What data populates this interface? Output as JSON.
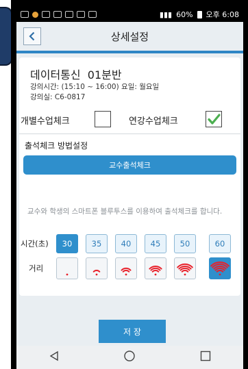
{
  "statusbar": {
    "signal": "60%",
    "time": "오후 6:08"
  },
  "header": {
    "title": "상세설정",
    "back_icon": "chevron-left-icon"
  },
  "course": {
    "name": "데이터통신  01분반",
    "time_line": "강의시간: (15:10 ~ 16:00)  요일: 월요일",
    "room_line": "강의실: C6-0817"
  },
  "checks": {
    "individual_label": "개별수업체크",
    "individual_checked": false,
    "consecutive_label": "연강수업체크",
    "consecutive_checked": true
  },
  "method": {
    "label": "출석체크 방법설정",
    "button_label": "교수출석체크",
    "description": "교수와 학생의 스마트폰 블루투스를 이용하여 출석체크를 합니다."
  },
  "time_row": {
    "label": "시간(초)",
    "options": [
      "30",
      "35",
      "40",
      "45",
      "50",
      "60"
    ],
    "selected_index": 0
  },
  "distance_row": {
    "label": "거리",
    "levels": 6,
    "selected_index": 5,
    "icon": "wifi-signal-icon",
    "color": "#e8202a"
  },
  "save_label": "저 장",
  "colors": {
    "accent": "#2f8fcc",
    "header_line": "#2f86c5",
    "check": "#4caf50"
  }
}
